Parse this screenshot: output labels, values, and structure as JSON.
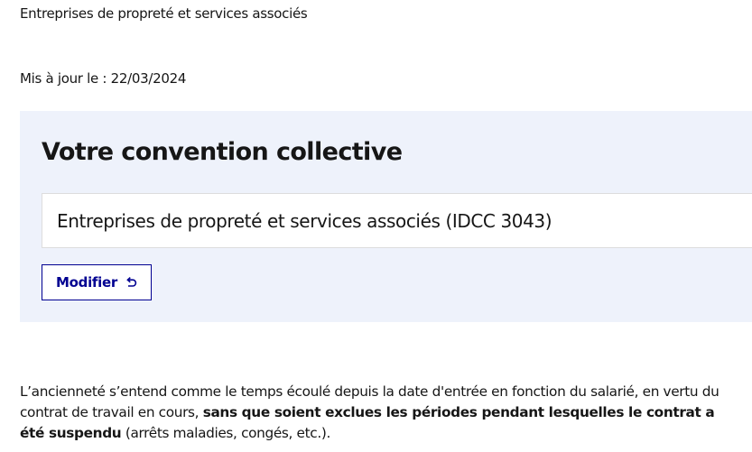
{
  "header": {
    "convention_name": "Entreprises de propreté et services associés",
    "updated_label": "Mis à jour le : 22/03/2024"
  },
  "convention_card": {
    "title": "Votre convention collective",
    "selected_value": "Entreprises de propreté et services associés (IDCC 3043)",
    "modify_label": "Modifier",
    "modify_icon": "undo-arrow-icon"
  },
  "content": {
    "para_part1": "L’ancienneté s’entend comme le temps écoulé depuis la date d'entrée en fonction du salarié, en vertu du contrat de travail en cours, ",
    "para_bold": "sans que soient exclues les périodes pendant lesquelles le contrat a été suspendu",
    "para_part2": " (arrêts maladies, congés, etc.)."
  },
  "colors": {
    "card_bg": "#eef2fb",
    "button_accent": "#000091",
    "text": "#161616"
  }
}
